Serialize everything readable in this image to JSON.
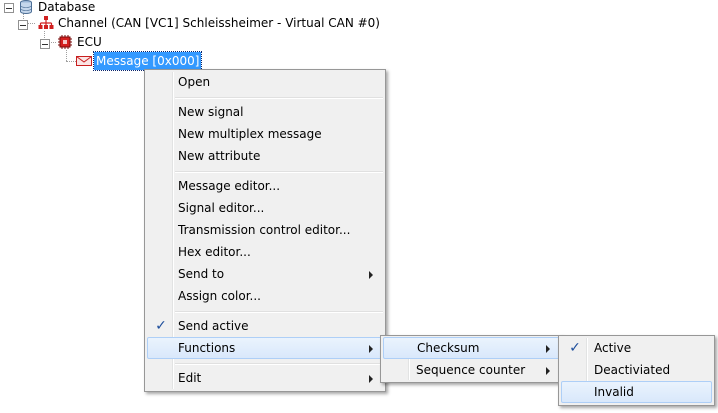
{
  "tree": {
    "database": "Database",
    "channel": "Channel (CAN [VC1] Schleissheimer - Virtual CAN #0)",
    "ecu": "ECU",
    "message": "Message [0x000]"
  },
  "context_menu": {
    "open": "Open",
    "new_signal": "New signal",
    "new_multiplex_message": "New multiplex message",
    "new_attribute": "New attribute",
    "message_editor": "Message editor...",
    "signal_editor": "Signal editor...",
    "transmission_control_editor": "Transmission control editor...",
    "hex_editor": "Hex editor...",
    "send_to": "Send to",
    "assign_color": "Assign color...",
    "send_active": "Send active",
    "functions": "Functions",
    "edit": "Edit"
  },
  "functions_submenu": {
    "checksum": "Checksum",
    "sequence_counter": "Sequence counter"
  },
  "checksum_submenu": {
    "active": "Active",
    "deactivated": "Deactiviated",
    "invalid": "Invalid"
  },
  "colors": {
    "selection": "#3399ff",
    "menu_background": "#f0f0f0",
    "highlight_border": "#aecff7",
    "check": "#1e4e9c"
  }
}
